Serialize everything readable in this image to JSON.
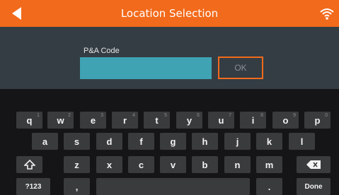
{
  "app": {
    "title": "Location Selection"
  },
  "form": {
    "label": "P&A Code",
    "input_value": "",
    "ok_label": "OK"
  },
  "keyboard": {
    "row1": [
      {
        "k": "q",
        "hint": "1"
      },
      {
        "k": "w",
        "hint": "2"
      },
      {
        "k": "e",
        "hint": "3"
      },
      {
        "k": "r",
        "hint": "4"
      },
      {
        "k": "t",
        "hint": "5"
      },
      {
        "k": "y",
        "hint": "6"
      },
      {
        "k": "u",
        "hint": "7"
      },
      {
        "k": "i",
        "hint": "8"
      },
      {
        "k": "o",
        "hint": "9"
      },
      {
        "k": "p",
        "hint": "0"
      }
    ],
    "row2": [
      "a",
      "s",
      "d",
      "f",
      "g",
      "h",
      "j",
      "k",
      "l"
    ],
    "row3": [
      "z",
      "x",
      "c",
      "v",
      "b",
      "n",
      "m"
    ],
    "mode_label": "?123",
    "comma": ",",
    "period": ".",
    "done_label": "Done"
  },
  "icons": {
    "back": "back-arrow-icon",
    "wifi": "wifi-icon",
    "shift": "shift-icon",
    "backspace": "backspace-icon"
  },
  "colors": {
    "accent": "#f26a1b",
    "input": "#3fa3b4",
    "panel": "#343d44",
    "key": "#3a3b3d"
  }
}
